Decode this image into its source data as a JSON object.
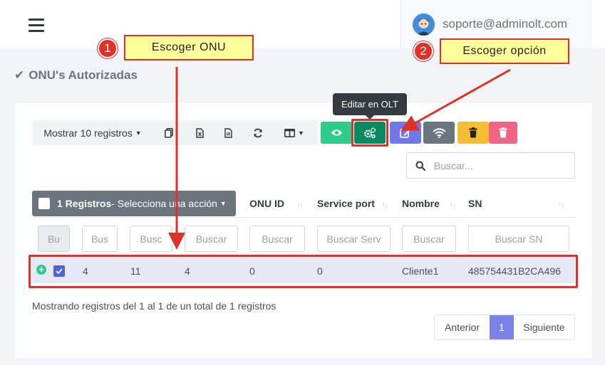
{
  "header": {
    "user_email": "soporte@adminolt.com"
  },
  "page": {
    "title": "ONU's Autorizadas"
  },
  "toolbar": {
    "show_records_label": "Mostrar 10 registros",
    "tooltip_label": "Editar en OLT",
    "colors": {
      "view": "#2dcc8a",
      "edit_olt": "#0a8a60",
      "edit": "#6f78e6",
      "wifi": "#6c757d",
      "delete_yellow": "#f6bc34",
      "delete_pink": "#f06585"
    }
  },
  "search": {
    "placeholder": "Buscar..."
  },
  "table": {
    "bulk_count": "1 Registros",
    "bulk_action": " - Selecciona una acción",
    "columns": [
      "ONU ID",
      "Service port",
      "Nombre",
      "SN"
    ],
    "filters": [
      "Bu",
      "Bus",
      "Busc",
      "Buscar",
      "Buscar",
      "Buscar Serv",
      "Buscar",
      "Buscar SN"
    ],
    "row": {
      "c1": "4",
      "c2": "11",
      "c3": "4",
      "onu_id": "0",
      "service_port": "0",
      "nombre": "Cliente1",
      "sn": "485754431B2CA496"
    }
  },
  "footer": {
    "info": "Mostrando registros del 1 al 1 de un total de 1 registros",
    "prev": "Anterior",
    "page": "1",
    "next": "Siguiente"
  },
  "annotations": {
    "step1_number": "1",
    "step1_label": "Escoger ONU",
    "step2_number": "2",
    "step2_label": "Escoger opción",
    "accent": "#e0302a"
  }
}
